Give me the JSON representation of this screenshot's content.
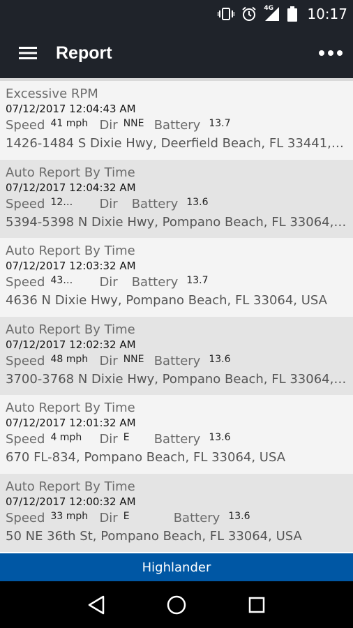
{
  "status_bar": {
    "time": "10:17",
    "icons": [
      "vibrate-icon",
      "alarm-icon",
      "signal-4g-icon",
      "battery-icon"
    ],
    "network": "4G"
  },
  "app_bar": {
    "title": "Report",
    "menu_icon": "hamburger-menu-icon",
    "overflow_icon": "more-vert-icon"
  },
  "labels": {
    "speed": "Speed",
    "dir": "Dir",
    "battery": "Battery"
  },
  "reports": [
    {
      "type": "Excessive RPM",
      "time": "07/12/2017 12:04:43 AM",
      "speed": "41 mph",
      "dir": "NNE",
      "battery": "13.7",
      "address": "1426-1484 S Dixie Hwy, Deerfield Beach, FL 33441,…"
    },
    {
      "type": "Auto Report By Time",
      "time": "07/12/2017 12:04:32 AM",
      "speed": "12…",
      "dir": "",
      "battery": "13.6",
      "address": "5394-5398 N Dixie Hwy, Pompano Beach, FL 33064,…"
    },
    {
      "type": "Auto Report By Time",
      "time": "07/12/2017 12:03:32 AM",
      "speed": "43…",
      "dir": "",
      "battery": "13.7",
      "address": "4636 N Dixie Hwy, Pompano Beach, FL 33064, USA"
    },
    {
      "type": "Auto Report By Time",
      "time": "07/12/2017 12:02:32 AM",
      "speed": "48 mph",
      "dir": "NNE",
      "battery": "13.6",
      "address": "3700-3768 N Dixie Hwy, Pompano Beach, FL 33064,…"
    },
    {
      "type": "Auto Report By Time",
      "time": "07/12/2017 12:01:32 AM",
      "speed": "4 mph",
      "dir": "E",
      "battery": "13.6",
      "address": "670 FL-834, Pompano Beach, FL 33064, USA"
    },
    {
      "type": "Auto Report By Time",
      "time": "07/12/2017 12:00:32 AM",
      "speed": "33 mph",
      "dir": "E",
      "battery": "13.6",
      "address": "50 NE 36th St, Pompano Beach, FL 33064, USA"
    }
  ],
  "footer": {
    "vehicle": "Highlander"
  },
  "nav_bar": {
    "buttons": [
      "back-icon",
      "home-icon",
      "recents-icon"
    ]
  },
  "colors": {
    "app_bar": "#1f232a",
    "footer": "#0057a4",
    "row_odd": "#f4f4f4",
    "row_even": "#e4e4e4"
  }
}
